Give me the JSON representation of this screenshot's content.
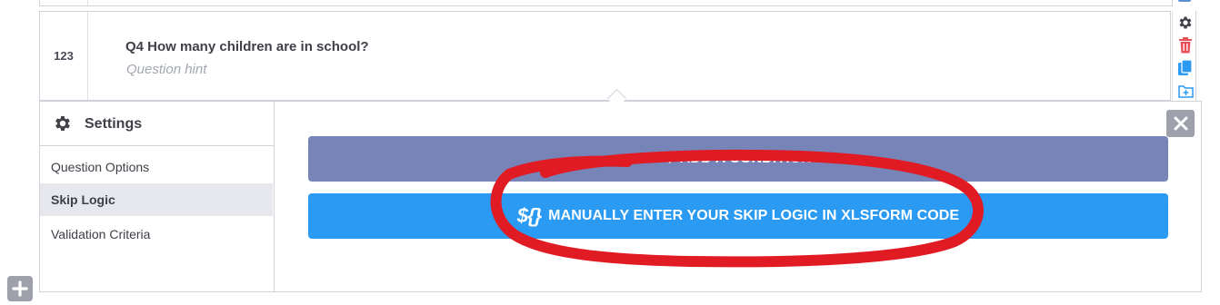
{
  "question": {
    "number": "123",
    "label": "Q4 How many children are in school?",
    "hint": "Question hint"
  },
  "row_actions": {
    "icons": [
      "gear-icon",
      "trash-icon",
      "duplicate-icon",
      "add-to-library-icon"
    ],
    "colors": {
      "gear": "#3f4048",
      "trash": "#e8505b",
      "duplicate": "#2b9af3",
      "library": "#2b9af3"
    }
  },
  "settings": {
    "title": "Settings",
    "nav": [
      {
        "label": "Question Options",
        "active": false
      },
      {
        "label": "Skip Logic",
        "active": true
      },
      {
        "label": "Validation Criteria",
        "active": false
      }
    ]
  },
  "skip_logic": {
    "add_condition_label": "ADD A CONDITION",
    "add_condition_symbol": "+",
    "manual_code_symbol": "${}",
    "manual_code_label": "MANUALLY ENTER YOUR SKIP LOGIC IN XLSFORM CODE"
  },
  "colors": {
    "add_condition_button": "#7684b8",
    "manual_button": "#2b9af3",
    "annotation_stroke": "#e01b24",
    "active_nav_bg": "#e7e8ee"
  }
}
